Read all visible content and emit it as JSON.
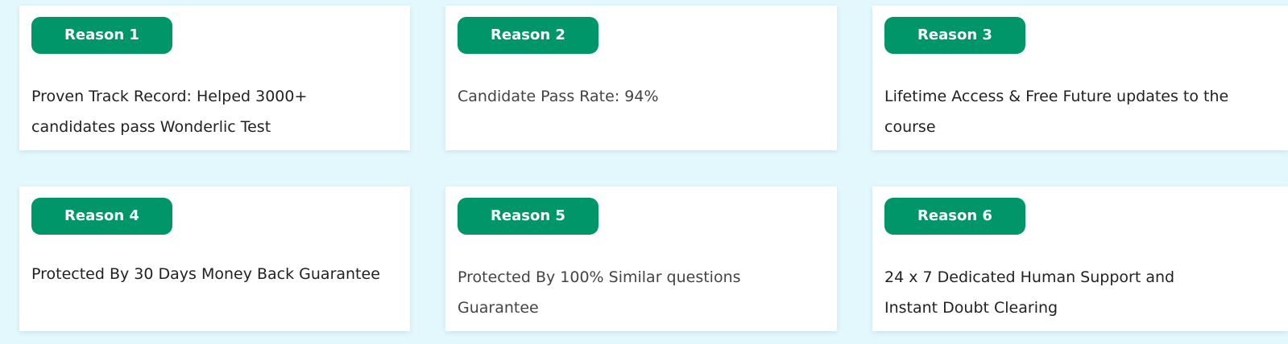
{
  "reasons": [
    {
      "badge": "Reason 1",
      "text": "Proven Track Record: Helped 3000+ candidates pass Wonderlic Test"
    },
    {
      "badge": "Reason 2",
      "text": "Candidate Pass Rate: 94%"
    },
    {
      "badge": "Reason 3",
      "text": "Lifetime Access & Free Future updates to the course"
    },
    {
      "badge": "Reason 4",
      "text": "Protected By 30 Days Money Back Guarantee"
    },
    {
      "badge": "Reason 5",
      "text": "Protected By 100% Similar questions Guarantee"
    },
    {
      "badge": "Reason 6",
      "text": "24 x 7 Dedicated Human Support  and Instant Doubt Clearing"
    }
  ],
  "colors": {
    "background": "#e3f8fd",
    "card": "#ffffff",
    "badge": "#009669",
    "badge_text": "#ffffff",
    "body_text": "#222222"
  }
}
